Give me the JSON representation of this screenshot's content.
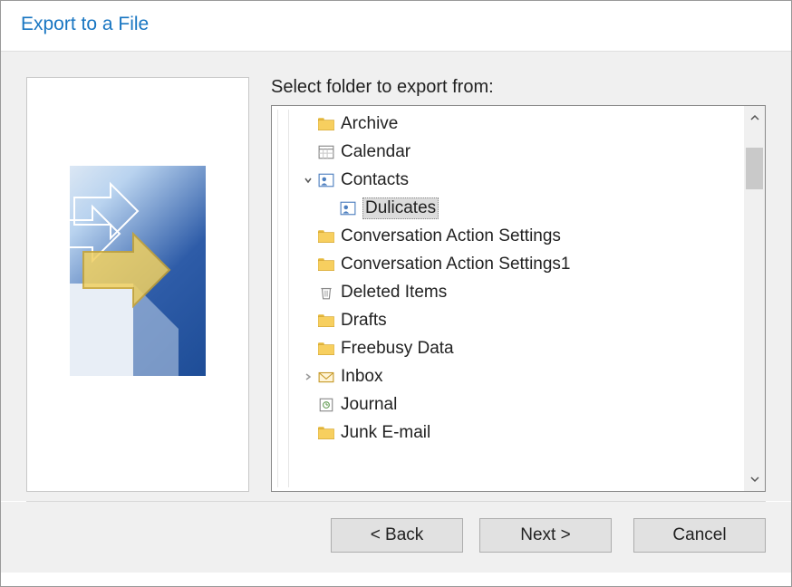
{
  "dialog": {
    "title": "Export to a File",
    "prompt": "Select folder to export from:"
  },
  "tree": {
    "items": [
      {
        "icon": "folder",
        "label": "Archive",
        "indent": 0,
        "expander": ""
      },
      {
        "icon": "calendar",
        "label": "Calendar",
        "indent": 0,
        "expander": ""
      },
      {
        "icon": "contacts",
        "label": "Contacts",
        "indent": 0,
        "expander": "open"
      },
      {
        "icon": "contacts",
        "label": "Dulicates",
        "indent": 1,
        "expander": "",
        "selected": true
      },
      {
        "icon": "folder",
        "label": "Conversation Action Settings",
        "indent": 0,
        "expander": ""
      },
      {
        "icon": "folder",
        "label": "Conversation Action Settings1",
        "indent": 0,
        "expander": ""
      },
      {
        "icon": "trash",
        "label": "Deleted Items",
        "indent": 0,
        "expander": ""
      },
      {
        "icon": "folder",
        "label": "Drafts",
        "indent": 0,
        "expander": ""
      },
      {
        "icon": "folder",
        "label": "Freebusy Data",
        "indent": 0,
        "expander": ""
      },
      {
        "icon": "inbox",
        "label": "Inbox",
        "indent": 0,
        "expander": "closed"
      },
      {
        "icon": "journal",
        "label": "Journal",
        "indent": 0,
        "expander": ""
      },
      {
        "icon": "folder",
        "label": "Junk E-mail",
        "indent": 0,
        "expander": ""
      }
    ]
  },
  "buttons": {
    "back": "< Back",
    "next": "Next >",
    "cancel": "Cancel"
  }
}
